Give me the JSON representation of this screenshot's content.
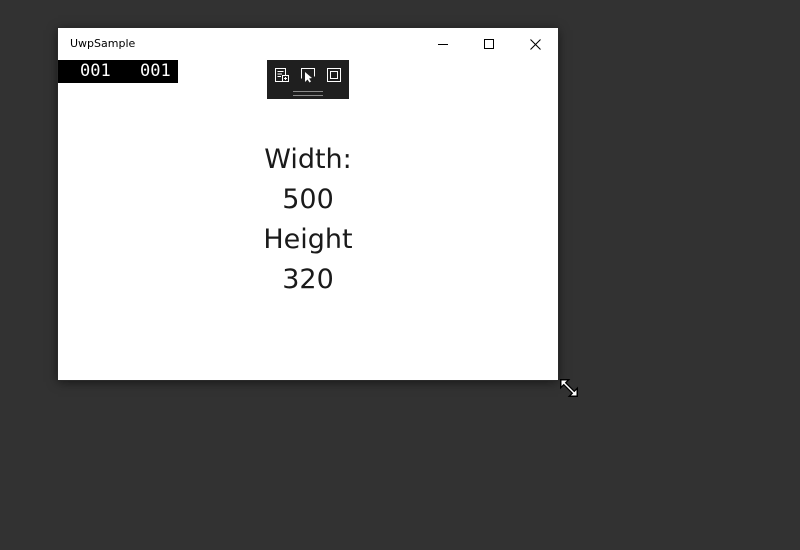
{
  "window": {
    "title": "UwpSample",
    "caption_buttons": {
      "minimize_icon": "minimize-icon",
      "maximize_icon": "maximize-icon",
      "close_icon": "close-icon"
    }
  },
  "frame_counter": {
    "value_1": "001",
    "value_2": "001"
  },
  "debug_toolbar": {
    "icons": [
      "live-visual-tree-icon",
      "select-element-icon",
      "display-layout-adorners-icon"
    ]
  },
  "content": {
    "width_label": "Width:",
    "width_value": "500",
    "height_label": "Height",
    "height_value": "320"
  },
  "cursor": {
    "icon": "diagonal-resize-cursor-icon"
  },
  "colors": {
    "desktop_background": "#323232",
    "window_background": "#ffffff",
    "frame_counter_background": "#000000",
    "toolbar_background": "#1f1f1f",
    "text": "#1a1a1a"
  }
}
